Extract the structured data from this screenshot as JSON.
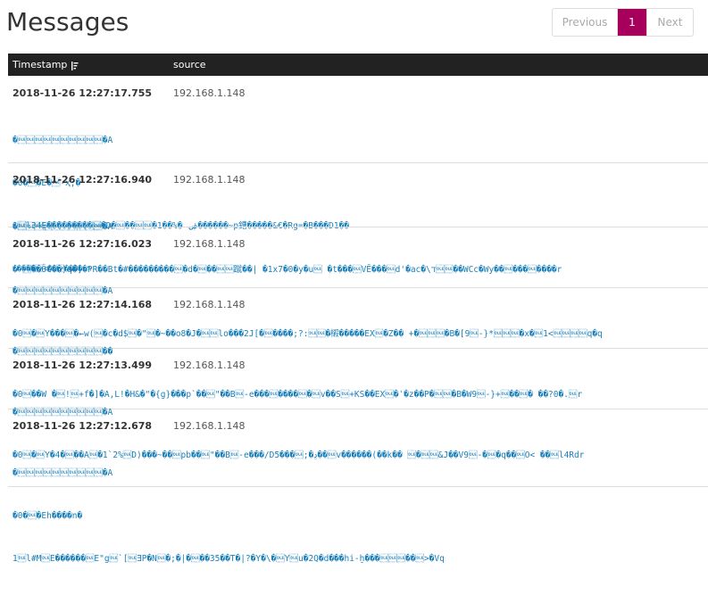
{
  "page": {
    "title": "Messages"
  },
  "pagination": {
    "previous": "Previous",
    "current": "1",
    "next": "Next"
  },
  "table": {
    "col_timestamp": "Timestamp",
    "col_source": "source"
  },
  "messages": [
    {
      "timestamp": "2018-11-26 12:27:17.755",
      "source": "192.168.1.148",
      "lines": [
        "�\u0010\u0010\u0010\u0010\u0010\u0010\u0010\u0010\u0010\u0010�A",
        "�0�\u0010�E�\u0010-ҳ;�",
        "1\u0010l34Ę���������\u0010�D�\u0010��\u0010\u0010�1��%� ۻ������~p鏪�����&€�Rg=�B���D1��",
        "'����\u0010<��\u0010����=ר"
      ]
    },
    {
      "timestamp": "2018-11-26 12:27:16.940",
      "source": "192.168.1.148",
      "lines": [
        "�\u0010\u0010\u0010\u0010\u0010\u0010\u0010\u0010\u0010\u0010�A",
        "� \u0010��ÔC��)q�]�PR��Bt�#���������\u0010�d�\u0010��\u0010\u0010蹴��| �1x7�0�y�u\u0010 �t���\u0010VĒ���\u0010d'�ac�\\ד\u0010\u0010��WCc�Wy��\u0010���\u0010����r"
      ]
    },
    {
      "timestamp": "2018-11-26 12:27:16.023",
      "source": "192.168.1.148",
      "lines": [
        "�\u0010\u0010\u0010\u0010\u0010\u0010\u0010\u0010\u0010\u0010�A",
        "�0\u0010�\u0010Y���\u0010�⇜w(\u0010�c�d$\u0010�\"\u0010�~��o8�J�\u0010\u0010lo���2J[�\u0010����;?:\u0010\u0010�樧�����EX\u0010�Z�� +�\u0010\u0010\u0010�B�[9\u0010-}*\u0010\u0010\u0010�x�\u00101<\u0010\u0010\u0010\u0010q�q"
      ]
    },
    {
      "timestamp": "2018-11-26 12:27:14.168",
      "source": "192.168.1.148",
      "lines": [
        "�\u0010\u0010\u0010\u0010\u0010\u0010\u0010\u0010\u0010\u0010��",
        "�0\u0010��W �\u0010!\u0010+f�]�A,L!�H&�\"�{g}���p`��\u0010\"��B\u0010-e���\u0010����\u0010�\u0010v��S\u0010+KS��EX\u0010�ʿ�z��P�\u0010\u0010�B�W9\u0010-}+\u0010��\u0010� ��?0�.\u0010r"
      ]
    },
    {
      "timestamp": "2018-11-26 12:27:13.499",
      "source": "192.168.1.148",
      "lines": [
        "�\u0010\u0010\u0010\u0010\u0010\u0010\u0010\u0010\u0010\u0010�A",
        "�0\u0010�\u0010Y�4�\u0010��A\u0010�1`2%\u0010D)���~��\u0010pb��\u0010\"��B\u0010-e���/D5���\u0010;�ڍ��\u0010v������(��k�� \u0010�\u0010\u0010&J��V9\u0010-�\u0010�q��\u0010O< ��\u0010l4Rdr"
      ]
    },
    {
      "timestamp": "2018-11-26 12:27:12.678",
      "source": "192.168.1.148",
      "lines": [
        "�\u0010\u0010\u0010\u0010\u0010\u0010\u0010\u0010\u0010\u0010�A",
        "�0�\u0010�Eh����n�",
        "1\u0010l#M\u0010E������\u0010E\"g\u0010`[\u0010ƎP�N\u0010�;�|�\u0010��35��T�|?�Y�\\�\u0010Y\u0010u�2Q�d���hi-ẖ���\u0010\u0010\u0010��\u0010>�Vq"
      ]
    }
  ]
}
